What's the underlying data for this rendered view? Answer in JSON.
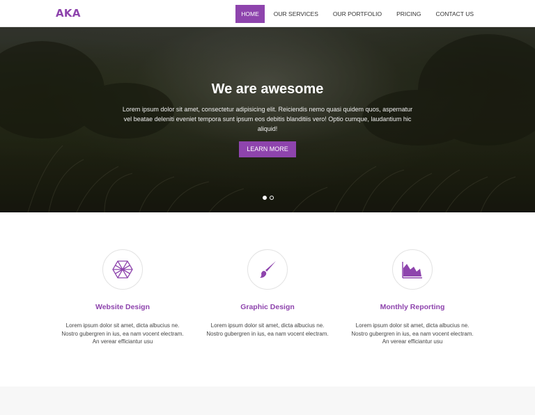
{
  "brand": {
    "logo": "AKA",
    "accent": "#8e44ad"
  },
  "nav": {
    "items": [
      {
        "label": "HOME",
        "active": true
      },
      {
        "label": "OUR SERVICES",
        "active": false
      },
      {
        "label": "OUR PORTFOLIO",
        "active": false
      },
      {
        "label": "PRICING",
        "active": false
      },
      {
        "label": "CONTACT US",
        "active": false
      }
    ]
  },
  "hero": {
    "title": "We are awesome",
    "text": "Lorem ipsum dolor sit amet, consectetur adipisicing elit. Reiciendis nemo quasi quidem quos, aspernatur vel beatae deleniti eveniet tempora sunt ipsum eos debitis blanditiis vero! Optio cumque, laudantium hic aliquid!",
    "button_label": "LEARN MORE",
    "slides": {
      "count": 2,
      "active_index": 0
    }
  },
  "services": [
    {
      "icon": "hexagon-icon",
      "title": "Website Design",
      "description": "Lorem ipsum dolor sit amet, dicta albucius ne. Nostro gubergren in ius, ea nam vocent electram. An verear efficiantur usu"
    },
    {
      "icon": "paintbrush-icon",
      "title": "Graphic Design",
      "description": "Lorem ipsum dolor sit amet, dicta albucius ne. Nostro gubergren in ius, ea nam vocent electram."
    },
    {
      "icon": "area-chart-icon",
      "title": "Monthly Reporting",
      "description": "Lorem ipsum dolor sit amet, dicta albucius ne. Nostro gubergren in ius, ea nam vocent electram. An verear efficiantur usu"
    }
  ]
}
